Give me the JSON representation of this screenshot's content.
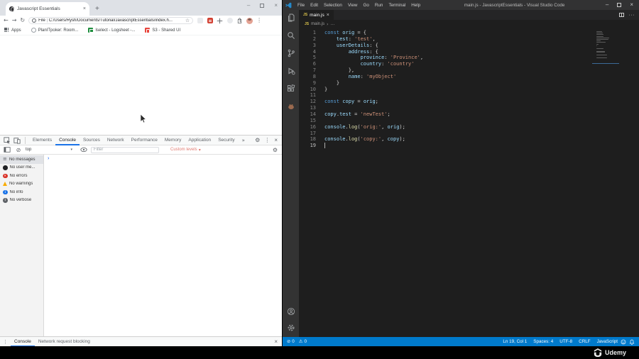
{
  "browser": {
    "tab_title": "Javascript Essentials",
    "tab_close": "×",
    "new_tab": "+",
    "window_controls": {
      "minimize": "–",
      "close": "×"
    },
    "nav": {
      "back": "←",
      "forward": "→",
      "refresh": "↻"
    },
    "url_scheme": "File",
    "url_divider": "|",
    "url": "C:/Users/Rysh/Documents/Tutorial/JavascriptEssentials/index.h...",
    "bookmark_star": "☆",
    "menu_kebab": "⋮",
    "bookmarks": [
      {
        "label": "Apps",
        "icon": "apps-grid"
      },
      {
        "label": "PlanITpoker: Room...",
        "icon": "ring"
      },
      {
        "label": "Iselect - Logsheet -...",
        "icon": "sheet"
      },
      {
        "label": "S3 - Shared UI",
        "icon": "s3"
      }
    ]
  },
  "devtools": {
    "tabs": [
      "Elements",
      "Console",
      "Sources",
      "Network",
      "Performance",
      "Memory",
      "Application",
      "Security"
    ],
    "active_tab": "Console",
    "overflow": "»",
    "gear": "⚙",
    "kebab": "⋮",
    "close": "×",
    "clear_icon": "⊘",
    "context_selector": "top",
    "caret": "▾",
    "filter_placeholder": "Filter",
    "levels_label": "Custom levels",
    "sidebar": [
      {
        "label": "No messages",
        "kind": "messages",
        "selected": true
      },
      {
        "label": "No user me...",
        "kind": "user",
        "selected": false
      },
      {
        "label": "No errors",
        "kind": "error",
        "selected": false
      },
      {
        "label": "No warnings",
        "kind": "warn",
        "selected": false
      },
      {
        "label": "No info",
        "kind": "info",
        "selected": false
      },
      {
        "label": "No verbose",
        "kind": "verbose",
        "selected": false
      }
    ],
    "sidebar_glyphs": {
      "messages": "≡",
      "user": "",
      "error": "×",
      "warn": "",
      "info": "i",
      "verbose": "i"
    },
    "prompt": "›",
    "drawer_tabs": [
      "Console",
      "Network request blocking"
    ],
    "drawer_active": "Console"
  },
  "vscode": {
    "menus": [
      "File",
      "Edit",
      "Selection",
      "View",
      "Go",
      "Run",
      "Terminal",
      "Help"
    ],
    "title": "main.js - JavascriptEssentials - Visual Studio Code",
    "window_controls": {
      "minimize": "–",
      "close": "×"
    },
    "tab": {
      "badge": "JS",
      "label": "main.js",
      "close": "×"
    },
    "breadcrumb": {
      "badge": "JS",
      "file": "main.js",
      "sep": "›",
      "more": "…"
    },
    "code_lines": [
      {
        "n": "1",
        "t": [
          [
            "const ",
            "kw"
          ],
          [
            "orig",
            "vr"
          ],
          [
            " = {",
            "pn"
          ]
        ]
      },
      {
        "n": "2",
        "t": [
          [
            "    ",
            ""
          ],
          [
            "test",
            "pr"
          ],
          [
            ": ",
            "pn"
          ],
          [
            "'test'",
            "st"
          ],
          [
            ",",
            "pn"
          ]
        ]
      },
      {
        "n": "3",
        "t": [
          [
            "    ",
            ""
          ],
          [
            "userDetails",
            "pr"
          ],
          [
            ": {",
            "pn"
          ]
        ]
      },
      {
        "n": "4",
        "t": [
          [
            "        ",
            ""
          ],
          [
            "address",
            "pr"
          ],
          [
            ": {",
            "pn"
          ]
        ]
      },
      {
        "n": "5",
        "t": [
          [
            "            ",
            ""
          ],
          [
            "province",
            "pr"
          ],
          [
            ": ",
            "pn"
          ],
          [
            "'Province'",
            "st"
          ],
          [
            ",",
            "pn"
          ]
        ]
      },
      {
        "n": "6",
        "t": [
          [
            "            ",
            ""
          ],
          [
            "country",
            "pr"
          ],
          [
            ": ",
            "pn"
          ],
          [
            "'country'",
            "st"
          ]
        ]
      },
      {
        "n": "7",
        "t": [
          [
            "        ",
            ""
          ],
          [
            "},",
            "pn"
          ]
        ]
      },
      {
        "n": "8",
        "t": [
          [
            "        ",
            ""
          ],
          [
            "name",
            "pr"
          ],
          [
            ": ",
            "pn"
          ],
          [
            "'myObject'",
            "st"
          ]
        ]
      },
      {
        "n": "9",
        "t": [
          [
            "    ",
            ""
          ],
          [
            "}",
            "pn"
          ]
        ]
      },
      {
        "n": "10",
        "t": [
          [
            "}",
            "pn"
          ]
        ]
      },
      {
        "n": "11",
        "t": []
      },
      {
        "n": "12",
        "t": [
          [
            "const ",
            "kw"
          ],
          [
            "copy",
            "vr"
          ],
          [
            " = ",
            "pn"
          ],
          [
            "orig",
            "vr"
          ],
          [
            ";",
            "pn"
          ]
        ]
      },
      {
        "n": "13",
        "t": []
      },
      {
        "n": "14",
        "t": [
          [
            "copy",
            "vr"
          ],
          [
            ".",
            "pn"
          ],
          [
            "test",
            "pr"
          ],
          [
            " = ",
            "pn"
          ],
          [
            "'newTest'",
            "st"
          ],
          [
            ";",
            "pn"
          ]
        ]
      },
      {
        "n": "15",
        "t": []
      },
      {
        "n": "16",
        "t": [
          [
            "console",
            "vr"
          ],
          [
            ".",
            "pn"
          ],
          [
            "log",
            "fn"
          ],
          [
            "(",
            "pn"
          ],
          [
            "'orig:'",
            "st"
          ],
          [
            ", ",
            "pn"
          ],
          [
            "orig",
            "vr"
          ],
          [
            ");",
            "pn"
          ]
        ]
      },
      {
        "n": "17",
        "t": []
      },
      {
        "n": "18",
        "t": [
          [
            "console",
            "vr"
          ],
          [
            ".",
            "pn"
          ],
          [
            "log",
            "fn"
          ],
          [
            "(",
            "pn"
          ],
          [
            "'copy:'",
            "st"
          ],
          [
            ", ",
            "pn"
          ],
          [
            "copy",
            "vr"
          ],
          [
            ");",
            "pn"
          ]
        ]
      },
      {
        "n": "19",
        "t": [],
        "cursor": true
      }
    ],
    "status_left": [
      {
        "icon": "⊘",
        "text": "0"
      },
      {
        "icon": "⚠",
        "text": "0"
      }
    ],
    "status_right": [
      "Ln 19, Col 1",
      "Spaces: 4",
      "UTF-8",
      "CRLF",
      "JavaScript"
    ]
  },
  "watermark": {
    "brand": "Udemy"
  },
  "colors": {
    "vscode_statusbar": "#007acc",
    "devtools_accent": "#1a73e8",
    "keyword": "#569cd6",
    "string": "#ce9178",
    "variable": "#9cdcfe",
    "method": "#dcdcaa"
  }
}
